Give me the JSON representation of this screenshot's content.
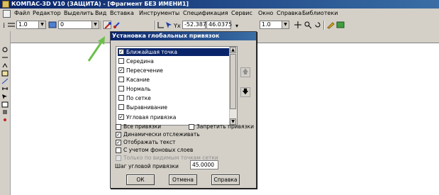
{
  "window": {
    "title": "КОМПАС-3D V10 (ЗАЩИТА) - [Фрагмент БЕЗ ИМЕНИ1]"
  },
  "menu": {
    "items": [
      "Файл",
      "Редактор",
      "Выделить",
      "Вид",
      "Вставка",
      "Инструменты",
      "Спецификация",
      "Сервис",
      "Окно",
      "Справка",
      "Библиотеки"
    ]
  },
  "toolbar": {
    "scale_value": "1.0",
    "layer_value": "0",
    "coord_x": "-52.387",
    "coord_y": "46.0375",
    "step_value": "1.0"
  },
  "dialog": {
    "title": "Установка глобальных привязок",
    "snaps": [
      {
        "label": "Ближайшая точка",
        "checked": true,
        "selected": true
      },
      {
        "label": "Середина",
        "checked": false,
        "selected": false
      },
      {
        "label": "Пересечение",
        "checked": true,
        "selected": false
      },
      {
        "label": "Касание",
        "checked": false,
        "selected": false
      },
      {
        "label": "Нормаль",
        "checked": false,
        "selected": false
      },
      {
        "label": "По сетке",
        "checked": false,
        "selected": false
      },
      {
        "label": "Выравнивание",
        "checked": false,
        "selected": false
      },
      {
        "label": "Угловая привязка",
        "checked": true,
        "selected": false
      }
    ],
    "options": {
      "all_snaps": {
        "label": "Все привязки",
        "checked": false
      },
      "forbid_snaps": {
        "label": "Запретить привязки",
        "checked": false
      },
      "dynamic_tracking": {
        "label": "Динамически отслеживать",
        "checked": true
      },
      "show_text": {
        "label": "Отображать текст",
        "checked": true
      },
      "background_layers": {
        "label": "С учетом фоновых слоев",
        "checked": false
      },
      "visible_grid_only": {
        "label": "Только по видимым точкам сетки",
        "checked": false,
        "disabled": true
      }
    },
    "angle_step_label": "Шаг угловой привязки",
    "angle_step_value": "45.0000",
    "buttons": {
      "ok": "ОК",
      "cancel": "Отмена",
      "help": "Справка"
    }
  },
  "colors": {
    "titlebar": "#0a246a",
    "selection": "#0a246a",
    "chrome": "#d4d0c8",
    "arrow": "#6cc04a"
  }
}
